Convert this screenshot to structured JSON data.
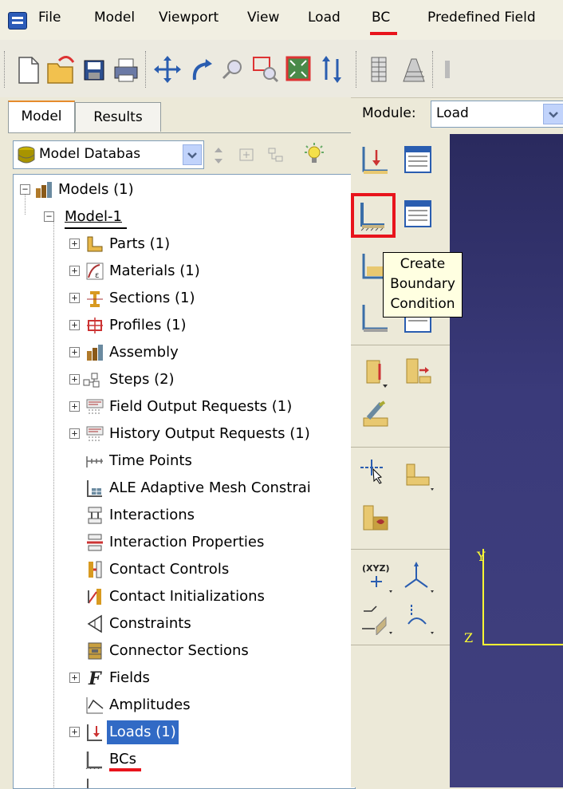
{
  "menubar": {
    "items": [
      {
        "label": "File"
      },
      {
        "label": "Model"
      },
      {
        "label": "Viewport"
      },
      {
        "label": "View"
      },
      {
        "label": "Load"
      },
      {
        "label": "BC"
      },
      {
        "label": "Predefined Field"
      }
    ],
    "highlighted_item": "BC"
  },
  "toolbar": {
    "icons": [
      "new-file-icon",
      "open-folder-icon",
      "save-icon",
      "print-icon",
      "pan-icon",
      "rotate-icon",
      "zoom-icon",
      "box-zoom-icon",
      "auto-fit-icon",
      "cycle-views-icon",
      "mesh-icon",
      "render-icon"
    ]
  },
  "tabs": {
    "model": "Model",
    "results": "Results"
  },
  "db_select": {
    "value": "Model Databas"
  },
  "module": {
    "label": "Module:",
    "value": "Load"
  },
  "tree": {
    "root": "Models (1)",
    "model": "Model-1",
    "items": [
      {
        "label": "Parts (1)",
        "icon": "parts-icon",
        "expandable": true
      },
      {
        "label": "Materials (1)",
        "icon": "materials-icon",
        "expandable": true
      },
      {
        "label": "Sections (1)",
        "icon": "sections-icon",
        "expandable": true
      },
      {
        "label": "Profiles (1)",
        "icon": "profiles-icon",
        "expandable": true
      },
      {
        "label": "Assembly",
        "icon": "assembly-icon",
        "expandable": true
      },
      {
        "label": "Steps (2)",
        "icon": "steps-icon",
        "expandable": true
      },
      {
        "label": "Field Output Requests (1)",
        "icon": "field-output-icon",
        "expandable": true
      },
      {
        "label": "History Output Requests (1)",
        "icon": "history-output-icon",
        "expandable": true
      },
      {
        "label": "Time Points",
        "icon": "time-points-icon",
        "expandable": false
      },
      {
        "label": "ALE Adaptive Mesh Constrai",
        "icon": "ale-mesh-icon",
        "expandable": false
      },
      {
        "label": "Interactions",
        "icon": "interactions-icon",
        "expandable": false
      },
      {
        "label": "Interaction Properties",
        "icon": "interaction-properties-icon",
        "expandable": false
      },
      {
        "label": "Contact Controls",
        "icon": "contact-controls-icon",
        "expandable": false
      },
      {
        "label": "Contact Initializations",
        "icon": "contact-init-icon",
        "expandable": false
      },
      {
        "label": "Constraints",
        "icon": "constraints-icon",
        "expandable": false
      },
      {
        "label": "Connector Sections",
        "icon": "connector-sections-icon",
        "expandable": false
      },
      {
        "label": "Fields",
        "icon": "fields-icon",
        "expandable": true
      },
      {
        "label": "Amplitudes",
        "icon": "amplitudes-icon",
        "expandable": false
      },
      {
        "label": "Loads (1)",
        "icon": "loads-icon",
        "expandable": true,
        "selected": true
      },
      {
        "label": "BCs",
        "icon": "bcs-icon",
        "expandable": false
      }
    ]
  },
  "tooltip": {
    "line1": "Create",
    "line2": "Boundary",
    "line3": "Condition"
  },
  "viewport": {
    "axis_y": "Y",
    "axis_z": "Z"
  },
  "colors": {
    "highlight_red": "#e8141c",
    "selection_blue": "#316ac5",
    "viewport_bg": "#3a3a7a"
  }
}
